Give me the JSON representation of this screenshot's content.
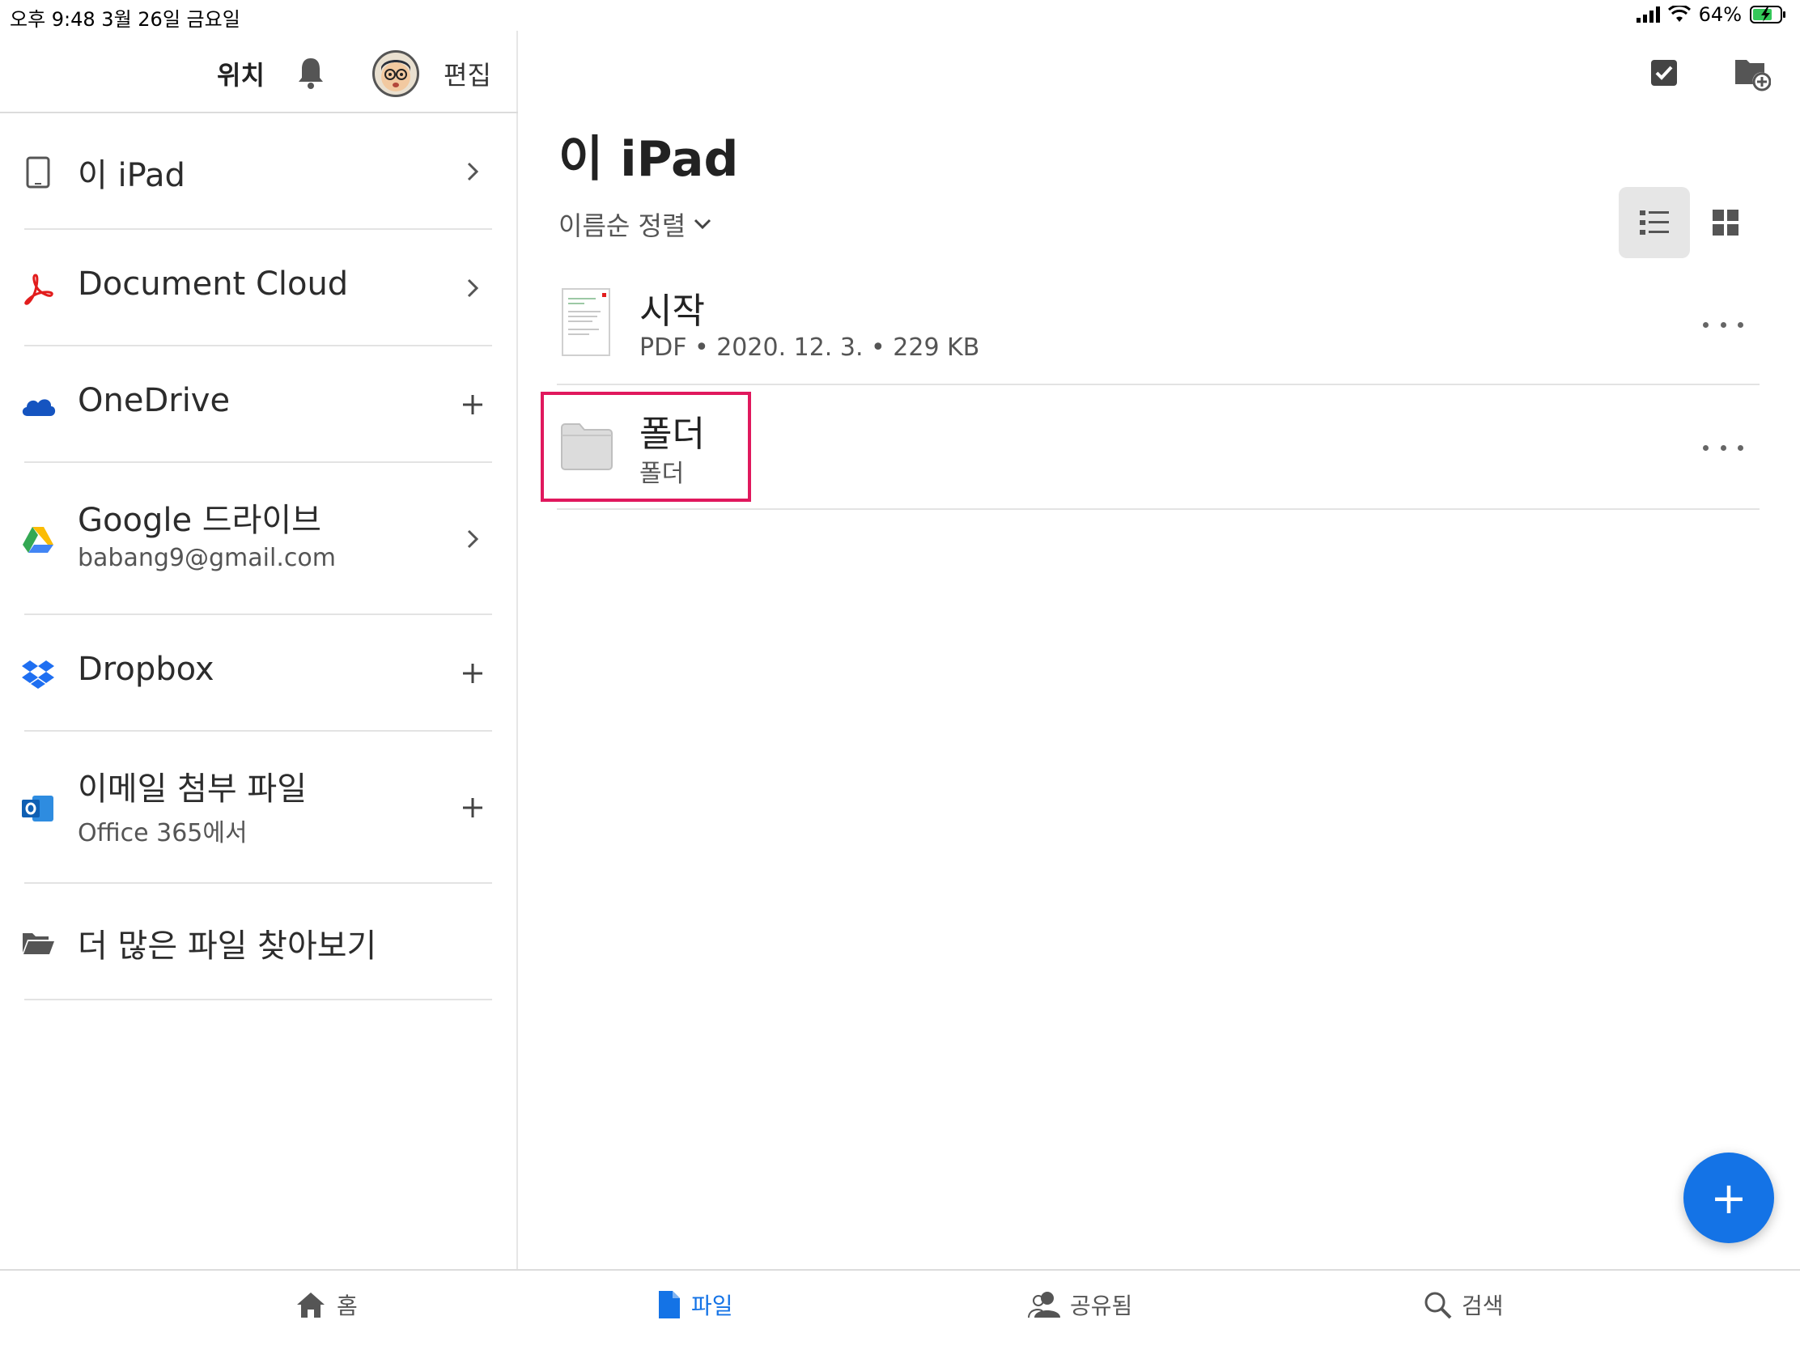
{
  "status_bar": {
    "time": "오후 9:48   3월 26일 금요일",
    "battery": "64%"
  },
  "sidebar": {
    "title": "위치",
    "edit_label": "편집",
    "items": [
      {
        "label": "이 iPad",
        "sublabel": "",
        "icon": "ipad-icon",
        "action": "chevron"
      },
      {
        "label": "Document Cloud",
        "sublabel": "",
        "icon": "acrobat-icon",
        "action": "chevron"
      },
      {
        "label": "OneDrive",
        "sublabel": "",
        "icon": "onedrive-icon",
        "action": "plus"
      },
      {
        "label": "Google 드라이브",
        "sublabel": "babang9@gmail.com",
        "icon": "google-drive-icon",
        "action": "chevron"
      },
      {
        "label": "Dropbox",
        "sublabel": "",
        "icon": "dropbox-icon",
        "action": "plus"
      },
      {
        "label": "이메일 첨부 파일",
        "sublabel": "Office 365에서",
        "icon": "outlook-icon",
        "action": "plus"
      },
      {
        "label": "더 많은 파일 찾아보기",
        "sublabel": "",
        "icon": "folder-open-icon",
        "action": "none"
      }
    ]
  },
  "main": {
    "title": "이 iPad",
    "sort_label": "이름순 정렬",
    "files": [
      {
        "name": "시작",
        "meta": "PDF  •  2020. 12. 3.  •  229 KB",
        "type": "pdf"
      },
      {
        "name": "폴더",
        "meta": "폴더",
        "type": "folder"
      }
    ]
  },
  "fab": {
    "label": "+"
  },
  "tabs": [
    {
      "label": "홈",
      "icon": "home-icon",
      "active": false
    },
    {
      "label": "파일",
      "icon": "file-icon",
      "active": true
    },
    {
      "label": "공유됨",
      "icon": "shared-people-icon",
      "active": false
    },
    {
      "label": "검색",
      "icon": "search-icon",
      "active": false
    }
  ],
  "colors": {
    "accent": "#1473e6",
    "highlight": "#e0185d",
    "acrobat": "#e21d1d",
    "onedrive": "#1554c0",
    "dropbox": "#1f6ff1",
    "outlook": "#1e72c8"
  }
}
